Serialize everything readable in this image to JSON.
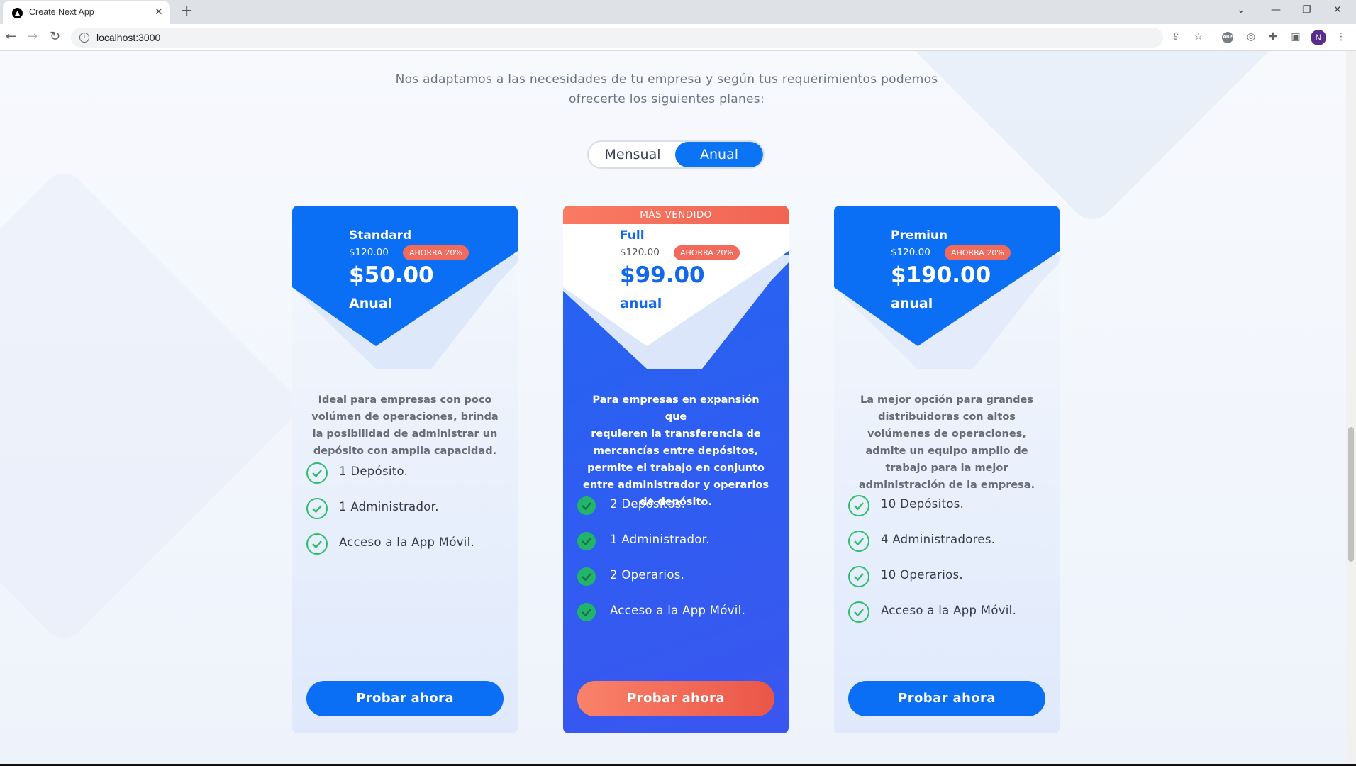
{
  "browser": {
    "tab_title": "Create Next App",
    "tab_close": "✕",
    "new_tab": "+",
    "url": "localhost:3000",
    "profile_initial": "N",
    "abp_label": "ABP"
  },
  "pricing": {
    "intro_line1": "Nos adaptamos a las necesidades de tu empresa y según tus requerimientos podemos",
    "intro_line2": "ofrecerte los siguientes planes:",
    "toggle": {
      "monthly": "Mensual",
      "annual": "Anual",
      "selected": "Anual"
    },
    "colors": {
      "accent": "#0b74f5",
      "badge": "#f16a5c",
      "check": "#22b46a"
    },
    "plans": [
      {
        "name": "Standard",
        "old_price": "$120.00",
        "badge": "AHORRA 20%",
        "price": "$50.00",
        "period": "Anual",
        "description": [
          "Ideal para empresas con poco",
          "volúmen de operaciones, brinda",
          "la posibilidad de administrar un",
          "depósito con amplia capacidad."
        ],
        "features": [
          "1 Depósito.",
          "1 Administrador.",
          "Acceso a la App Móvil."
        ],
        "cta": "Probar ahora"
      },
      {
        "ribbon": "MÁS VENDIDO",
        "name": "Full",
        "old_price": "$120.00",
        "badge": "AHORRA 20%",
        "price": "$99.00",
        "period": "anual",
        "description": [
          "Para empresas en expansión que",
          "requieren la transferencia de",
          "mercancías entre depósitos,",
          "permite el trabajo en conjunto",
          "entre administrador y operarios",
          "de depósito."
        ],
        "features": [
          "2 Depósitos.",
          "1 Administrador.",
          "2 Operarios.",
          "Acceso a la App Móvil."
        ],
        "cta": "Probar ahora"
      },
      {
        "name": "Premiun",
        "old_price": "$120.00",
        "badge": "AHORRA 20%",
        "price": "$190.00",
        "period": "anual",
        "description": [
          "La mejor opción para grandes",
          "distribuidoras con altos",
          "volúmenes de operaciones,",
          "admite un equipo amplio de",
          "trabajo para la mejor",
          "administración de la empresa."
        ],
        "features": [
          "10 Depósitos.",
          "4 Administradores.",
          "10 Operarios.",
          "Acceso a la App Móvil."
        ],
        "cta": "Probar ahora"
      }
    ]
  }
}
